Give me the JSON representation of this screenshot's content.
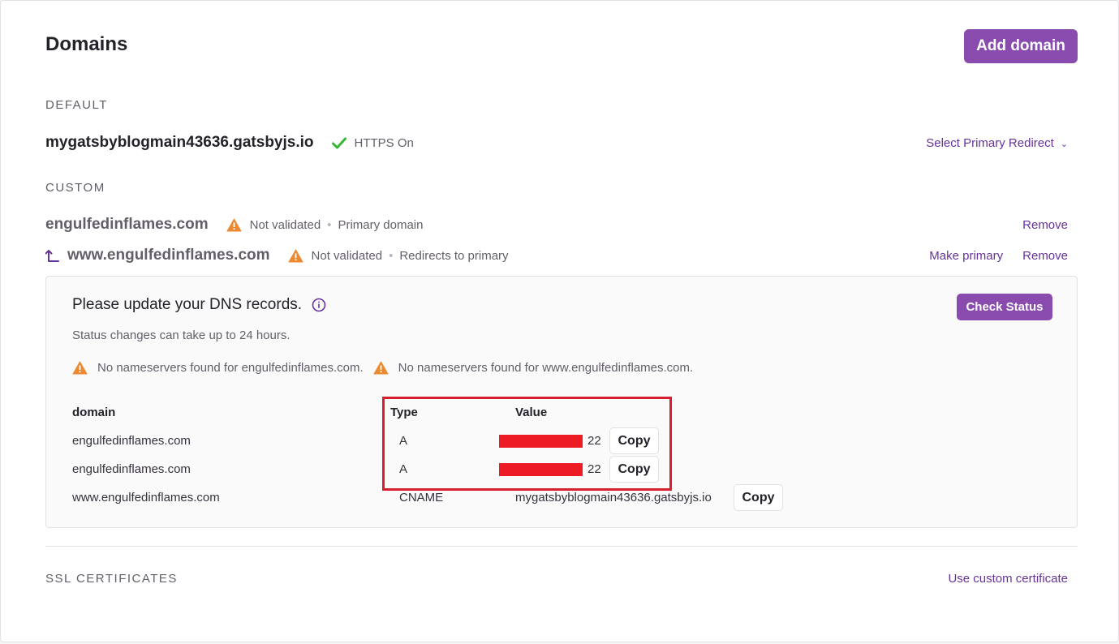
{
  "header": {
    "title": "Domains",
    "add_domain_label": "Add domain"
  },
  "default_section": {
    "label": "DEFAULT",
    "domain": "mygatsbyblogmain43636.gatsbyjs.io",
    "https_status": "HTTPS On",
    "redirect_select": "Select Primary Redirect"
  },
  "custom_section": {
    "label": "CUSTOM",
    "domains": [
      {
        "name": "engulfedinflames.com",
        "status": "Not validated",
        "detail": "Primary domain",
        "actions": [
          "Remove"
        ]
      },
      {
        "name": "www.engulfedinflames.com",
        "status": "Not validated",
        "detail": "Redirects to primary",
        "actions": [
          "Make primary",
          "Remove"
        ]
      }
    ]
  },
  "dns": {
    "title": "Please update your DNS records.",
    "check_status_label": "Check Status",
    "note": "Status changes can take up to 24 hours.",
    "warnings": [
      "No nameservers found for engulfedinflames.com.",
      "No nameservers found for www.engulfedinflames.com."
    ],
    "table": {
      "headers": {
        "domain": "domain",
        "type": "Type",
        "value": "Value"
      },
      "rows": [
        {
          "domain": "engulfedinflames.com",
          "type": "A",
          "value": "22",
          "copy_label": "Copy"
        },
        {
          "domain": "engulfedinflames.com",
          "type": "A",
          "value": "22",
          "copy_label": "Copy"
        },
        {
          "domain": "www.engulfedinflames.com",
          "type": "CNAME",
          "value": "mygatsbyblogmain43636.gatsbyjs.io",
          "copy_label": "Copy"
        }
      ]
    }
  },
  "ssl_section": {
    "label": "SSL CERTIFICATES",
    "custom_cert_label": "Use custom certificate"
  },
  "colors": {
    "accent": "#8a4baf",
    "link": "#663399",
    "success": "#37b635",
    "warning": "#ec8a32",
    "highlight": "#d62030"
  }
}
